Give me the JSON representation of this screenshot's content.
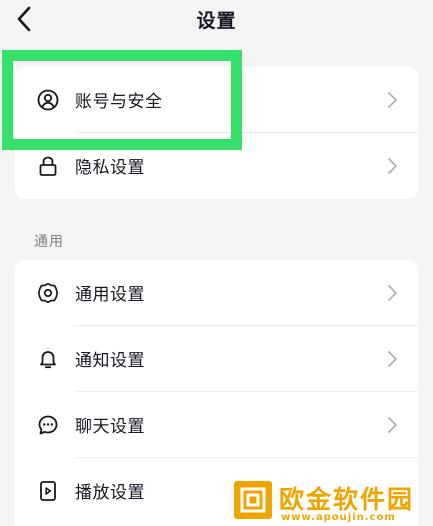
{
  "header": {
    "title": "设置",
    "back_icon": "chevron-left-icon"
  },
  "account_section": {
    "items": [
      {
        "label": "账号与安全",
        "icon": "user-circle-icon"
      },
      {
        "label": "隐私设置",
        "icon": "lock-icon"
      }
    ]
  },
  "general_section": {
    "title": "通用",
    "items": [
      {
        "label": "通用设置",
        "icon": "gear-icon"
      },
      {
        "label": "通知设置",
        "icon": "bell-icon"
      },
      {
        "label": "聊天设置",
        "icon": "chat-bubble-icon"
      },
      {
        "label": "播放设置",
        "icon": "play-device-icon"
      }
    ]
  },
  "watermark": {
    "name": "欧金软件园",
    "url": "www.apoujin.com"
  },
  "colors": {
    "highlight": "#35e06b",
    "background": "#f4f4f4",
    "watermark": "#f0a400"
  }
}
